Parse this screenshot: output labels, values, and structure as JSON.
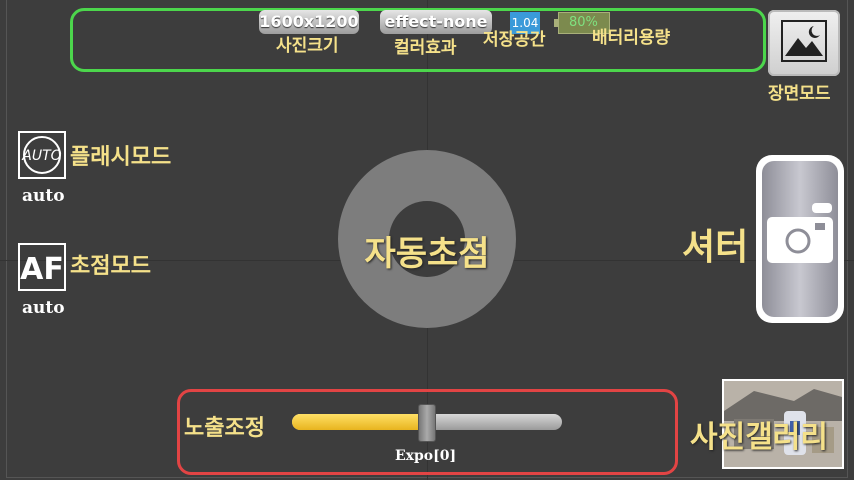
{
  "status": {
    "photo_size_value": "1600x1200",
    "photo_size_label": "사진크기",
    "color_effect_value": "effect-none",
    "color_effect_label": "컬러효과",
    "storage_value": "1.04",
    "storage_label": "저장공간",
    "battery_value": "80%",
    "battery_level": 0.8,
    "battery_label": "배터리용량"
  },
  "scene_mode": {
    "label": "장면모드",
    "icon": "landscape-night-icon"
  },
  "flash_mode": {
    "label": "플래시모드",
    "value": "auto",
    "icon": "flash-auto-icon"
  },
  "focus_mode": {
    "label": "초점모드",
    "value": "auto",
    "icon": "af-icon"
  },
  "auto_focus": {
    "label": "자동초점"
  },
  "shutter": {
    "label": "셔터",
    "icon": "camera-icon"
  },
  "gallery": {
    "label": "사진갤러리"
  },
  "exposure": {
    "label": "노출조정",
    "value_text": "Expo[0]",
    "level": 0.5
  },
  "colors": {
    "accent_green": "#4cd64c",
    "accent_red": "#e24444",
    "label_yellow": "#f5e18a"
  }
}
